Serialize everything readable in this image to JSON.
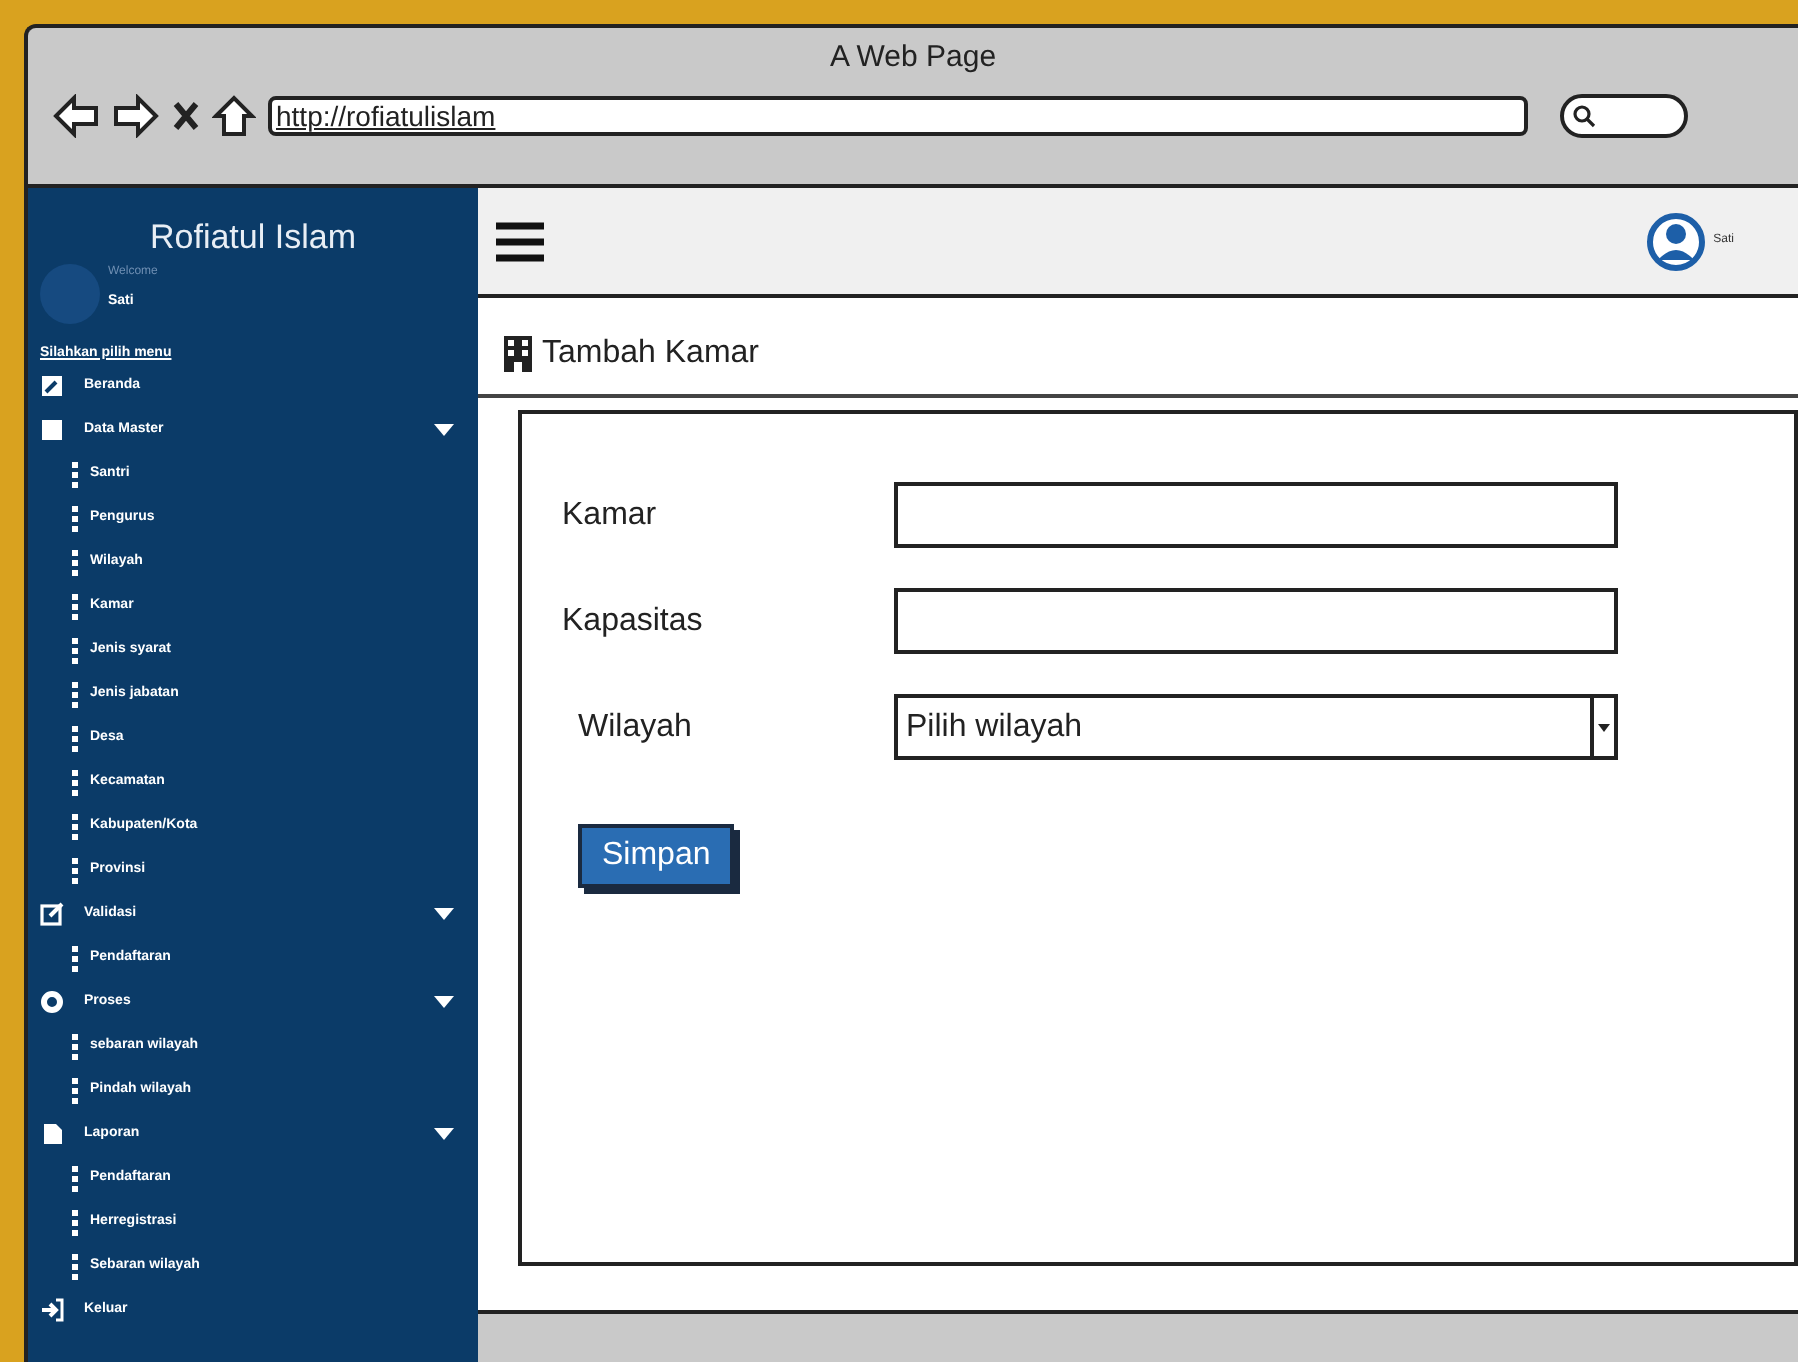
{
  "browser": {
    "title": "A Web Page",
    "url": "http://rofiatulislam"
  },
  "sidebar": {
    "title": "Rofiatul Islam",
    "welcome": "Welcome",
    "user": "Sati",
    "prompt": "Silahkan pilih menu",
    "items": [
      {
        "label": "Beranda"
      },
      {
        "label": "Data Master",
        "children": [
          {
            "label": "Santri"
          },
          {
            "label": "Pengurus"
          },
          {
            "label": "Wilayah"
          },
          {
            "label": "Kamar"
          },
          {
            "label": "Jenis syarat"
          },
          {
            "label": "Jenis jabatan"
          },
          {
            "label": "Desa"
          },
          {
            "label": "Kecamatan"
          },
          {
            "label": "Kabupaten/Kota"
          },
          {
            "label": "Provinsi"
          }
        ]
      },
      {
        "label": "Validasi",
        "children": [
          {
            "label": "Pendaftaran"
          }
        ]
      },
      {
        "label": "Proses",
        "children": [
          {
            "label": "sebaran wilayah"
          },
          {
            "label": "Pindah wilayah"
          }
        ]
      },
      {
        "label": "Laporan",
        "children": [
          {
            "label": "Pendaftaran"
          },
          {
            "label": "Herregistrasi"
          },
          {
            "label": "Sebaran wilayah"
          }
        ]
      },
      {
        "label": "Keluar"
      }
    ]
  },
  "header": {
    "user": "Sati"
  },
  "page": {
    "title": "Tambah Kamar",
    "fields": [
      {
        "kind": "text",
        "label": "Kamar"
      },
      {
        "kind": "text",
        "label": "Kapasitas"
      },
      {
        "kind": "select",
        "label": "Wilayah",
        "value": "Pilih wilayah"
      }
    ],
    "button": "Simpan"
  }
}
